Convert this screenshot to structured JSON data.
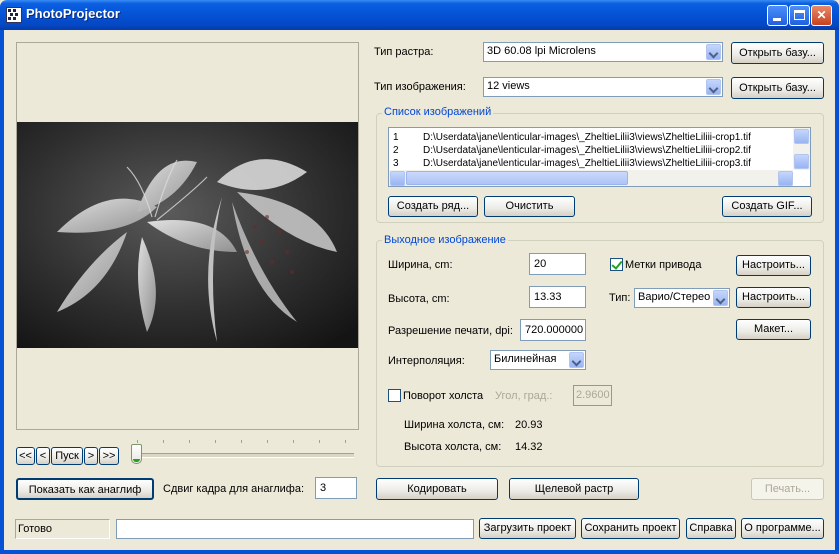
{
  "window": {
    "title": "PhotoProjector"
  },
  "raster": {
    "label": "Тип растра:",
    "value": "3D 60.08 lpi Microlens",
    "open_db": "Открыть базу..."
  },
  "image_type": {
    "label": "Тип изображения:",
    "value": "12 views",
    "open_db": "Открыть базу..."
  },
  "image_list": {
    "title": "Список изображений",
    "rows": [
      {
        "n": "1",
        "path": "D:\\Userdata\\jane\\lenticular-images\\_ZheltieLilii3\\views\\ZheltieLiliii-crop1.tif"
      },
      {
        "n": "2",
        "path": "D:\\Userdata\\jane\\lenticular-images\\_ZheltieLilii3\\views\\ZheltieLiliii-crop2.tif"
      },
      {
        "n": "3",
        "path": "D:\\Userdata\\jane\\lenticular-images\\_ZheltieLilii3\\views\\ZheltieLiliii-crop3.tif"
      }
    ],
    "create_row": "Создать ряд...",
    "clear": "Очистить",
    "create_gif": "Создать GIF..."
  },
  "output": {
    "title": "Выходное изображение",
    "width_label": "Ширина, cm:",
    "width_value": "20",
    "height_label": "Высота,  cm:",
    "height_value": "13.33",
    "resolution_label": "Разрешение печати, dpi:",
    "resolution_value": "720.000000",
    "interp_label": "Интерполяция:",
    "interp_value": "Билинейная",
    "marks_label": "Метки привода",
    "marks_checked": true,
    "configure1": "Настроить...",
    "type_label": "Тип:",
    "type_value": "Варио/Стерео",
    "configure2": "Настроить...",
    "layout": "Макет...",
    "rotate_label": "Поворот холста",
    "rotate_checked": false,
    "angle_label": "Угол, град.:",
    "angle_value": "2.9600",
    "canvas_width_label": "Ширина холста, см:",
    "canvas_width_value": "20.93",
    "canvas_height_label": "Высота холста,  см:",
    "canvas_height_value": "14.32"
  },
  "playback": {
    "first": "<<",
    "prev": "<",
    "play": "Пуск",
    "next": ">",
    "last": ">>",
    "slider_position": 0
  },
  "anaglyph": {
    "show_button": "Показать как анаглиф",
    "shift_label": "Сдвиг кадра для анаглифа:",
    "shift_value": "3"
  },
  "actions": {
    "encode": "Кодировать",
    "slit_raster": "Щелевой растр",
    "print": "Печать..."
  },
  "statusbar": {
    "status": "Готово",
    "load_project": "Загрузить проект",
    "save_project": "Сохранить проект",
    "help": "Справка",
    "about": "О программе..."
  }
}
